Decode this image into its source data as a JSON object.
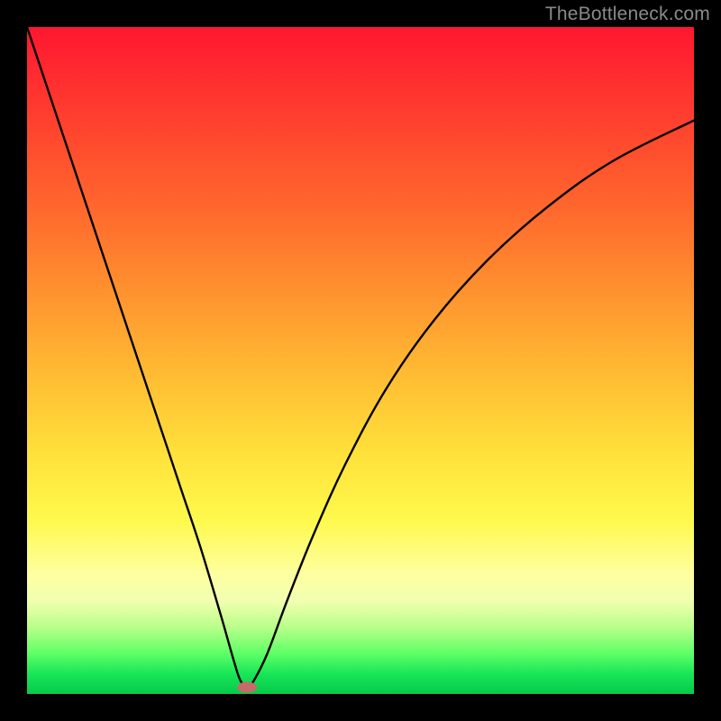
{
  "watermark": {
    "text": "TheBottleneck.com"
  },
  "chart_data": {
    "type": "line",
    "title": "",
    "xlabel": "",
    "ylabel": "",
    "xlim": [
      0,
      100
    ],
    "ylim": [
      0,
      100
    ],
    "grid": false,
    "series": [
      {
        "name": "bottleneck-curve",
        "x": [
          0,
          2,
          5,
          8,
          11,
          14,
          17,
          20,
          23,
          26,
          29,
          31,
          32,
          33,
          34,
          36,
          39,
          43,
          48,
          54,
          61,
          69,
          78,
          88,
          100
        ],
        "y": [
          100,
          94,
          85,
          76,
          67,
          58,
          49,
          40,
          31,
          22,
          12,
          5,
          2,
          1,
          2,
          6,
          14,
          24,
          35,
          46,
          56,
          65,
          73,
          80,
          86
        ]
      }
    ],
    "annotations": [
      {
        "name": "minimum-marker",
        "x": 33,
        "y": 1,
        "shape": "ellipse",
        "color": "#c66a6a"
      }
    ],
    "background_gradient": {
      "direction": "vertical",
      "stops": [
        {
          "pos": 0.0,
          "color": "#ff1630"
        },
        {
          "pos": 0.4,
          "color": "#ff932f"
        },
        {
          "pos": 0.74,
          "color": "#fff94d"
        },
        {
          "pos": 0.88,
          "color": "#e8ffb0"
        },
        {
          "pos": 1.0,
          "color": "#07c94a"
        }
      ]
    }
  }
}
